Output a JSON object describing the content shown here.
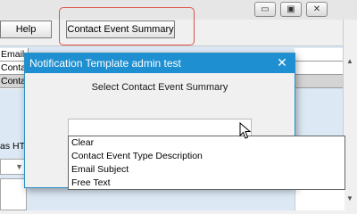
{
  "window": {
    "minimize_glyph": "▭",
    "maximize_glyph": "▣",
    "close_glyph": "✕"
  },
  "toolbar": {
    "help_label": "Help",
    "summary_label": "Contact Event Summary"
  },
  "grid": {
    "rows": [
      "Email Subj",
      "Contact E",
      "Contact E"
    ]
  },
  "labels": {
    "htm_label": "as HTML"
  },
  "dialog": {
    "title": "Notification Template admin test",
    "close_glyph": "✕",
    "prompt": "Select Contact Event Summary",
    "combo_value": ""
  },
  "dropdown": {
    "options": [
      "Clear",
      "Contact Event Type Description",
      "Email Subject",
      "Free Text"
    ]
  },
  "colors": {
    "dialog_titlebar": "#1e8fd0",
    "highlight_outline": "#e0524a",
    "panel_blue": "#dce8f4"
  }
}
